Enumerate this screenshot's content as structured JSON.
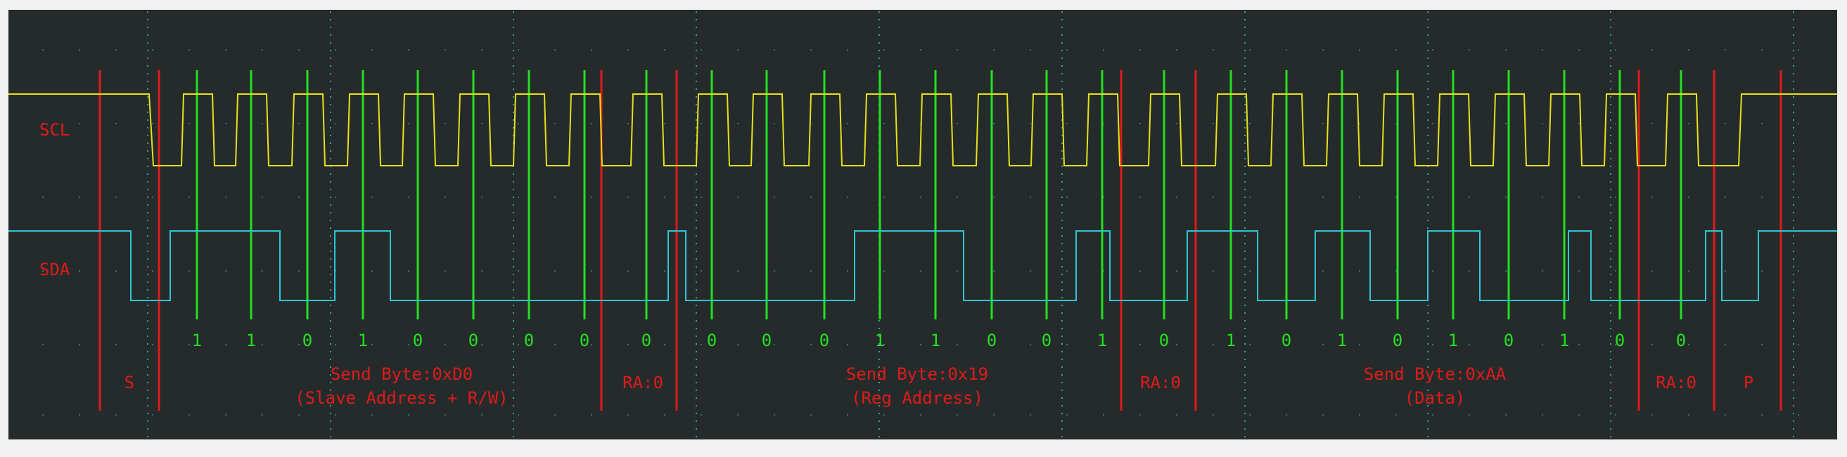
{
  "colors": {
    "background": "#252b2b",
    "frame": "#f2f2f2",
    "scl": "#e6e01a",
    "sda": "#2fc4d6",
    "bit_marker": "#22e022",
    "boundary_marker": "#e01a1a",
    "label": "#e01a1a",
    "bit_text": "#22e022",
    "grid": "#2fa89a"
  },
  "channels": [
    {
      "id": "scl",
      "label": "SCL"
    },
    {
      "id": "sda",
      "label": "SDA"
    }
  ],
  "bits": [
    "1",
    "1",
    "0",
    "1",
    "0",
    "0",
    "0",
    "0",
    "0",
    "0",
    "0",
    "0",
    "1",
    "1",
    "0",
    "0",
    "1",
    "0",
    "1",
    "0",
    "1",
    "0",
    "1",
    "0",
    "1",
    "0",
    "0"
  ],
  "segments": [
    {
      "id": "start",
      "line1": "S",
      "line2": ""
    },
    {
      "id": "byte1",
      "line1": "Send Byte:0xD0",
      "line2": "(Slave Address + R/W)"
    },
    {
      "id": "ack1",
      "line1": "RA:0",
      "line2": ""
    },
    {
      "id": "byte2",
      "line1": "Send Byte:0x19",
      "line2": "(Reg Address)"
    },
    {
      "id": "ack2",
      "line1": "RA:0",
      "line2": ""
    },
    {
      "id": "byte3",
      "line1": "Send Byte:0xAA",
      "line2": "(Data)"
    },
    {
      "id": "ack3",
      "line1": "RA:0",
      "line2": ""
    },
    {
      "id": "stop",
      "line1": "P",
      "line2": ""
    }
  ]
}
